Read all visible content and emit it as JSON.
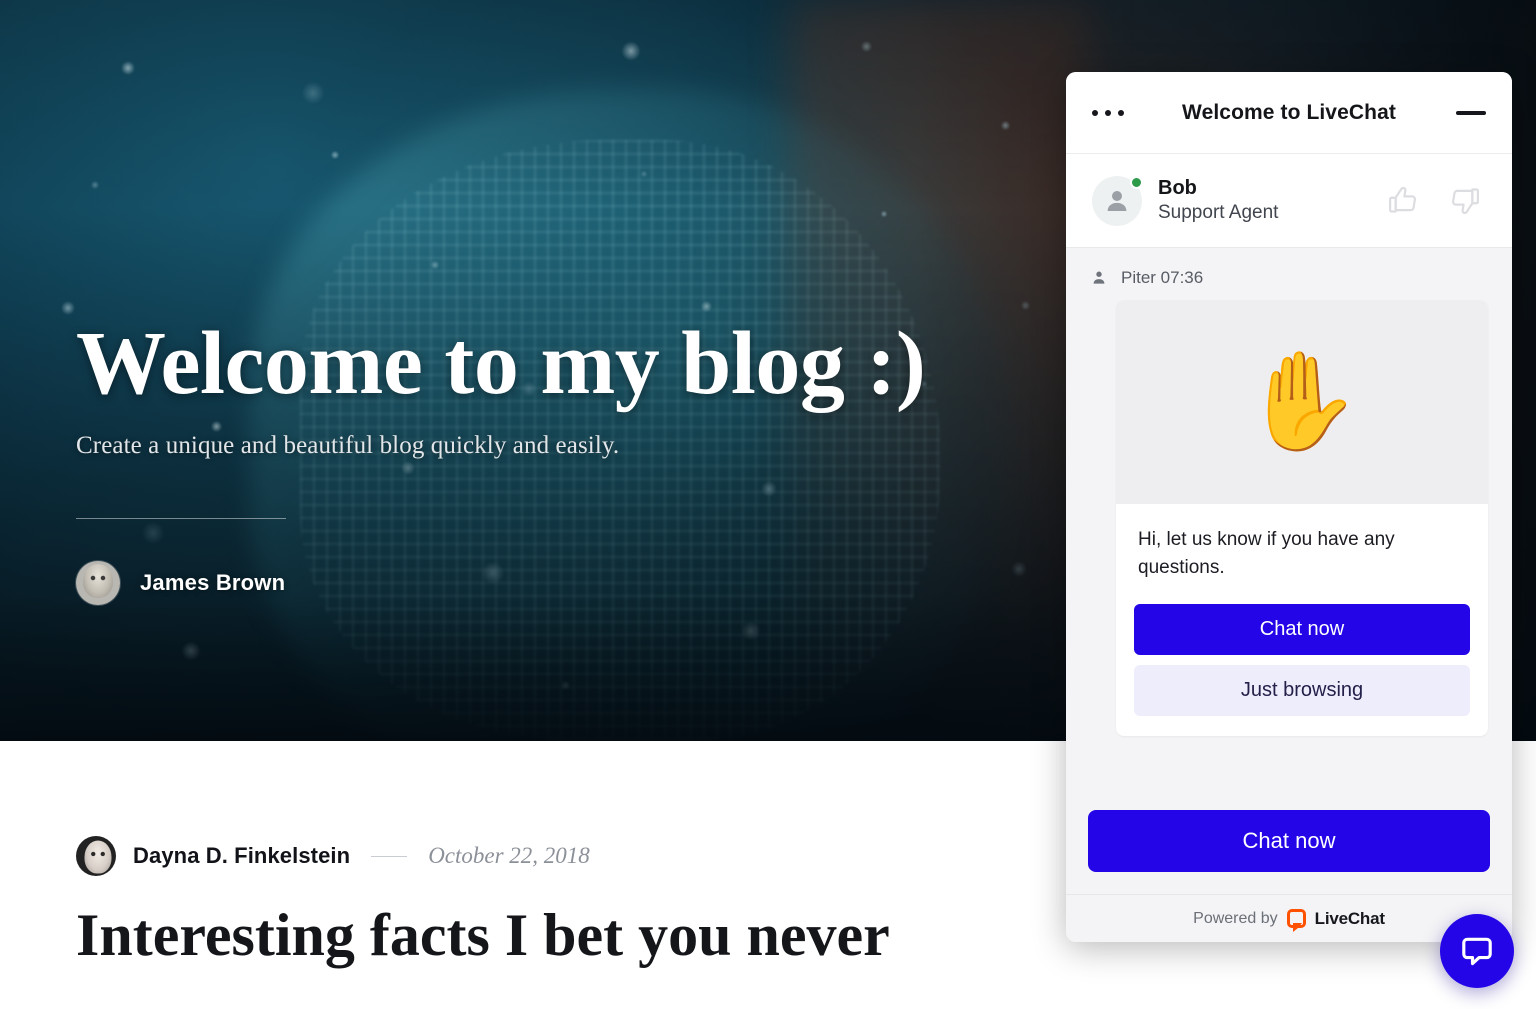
{
  "hero": {
    "title": "Welcome to my blog :)",
    "subtitle": "Create a unique and beautiful blog quickly and easily.",
    "author_name": "James Brown"
  },
  "article": {
    "author": "Dayna D. Finkelstein",
    "date": "October 22, 2018",
    "title": "Interesting facts I bet you never"
  },
  "widget": {
    "title": "Welcome to LiveChat",
    "agent": {
      "name": "Bob",
      "role": "Support Agent",
      "status": "online"
    },
    "message": {
      "meta": "Piter 07:36",
      "emoji": "✋",
      "text": "Hi, let us know if you have any questions.",
      "primary_label": "Chat now",
      "secondary_label": "Just browsing"
    },
    "cta_label": "Chat now",
    "footer": {
      "powered_by": "Powered by",
      "brand": "LiveChat"
    }
  },
  "colors": {
    "primary": "#2305e8",
    "secondary_button": "#eeedfb",
    "brand_orange": "#ff5100",
    "online_green": "#2e9b4a",
    "chat_background": "#f4f4f6"
  }
}
